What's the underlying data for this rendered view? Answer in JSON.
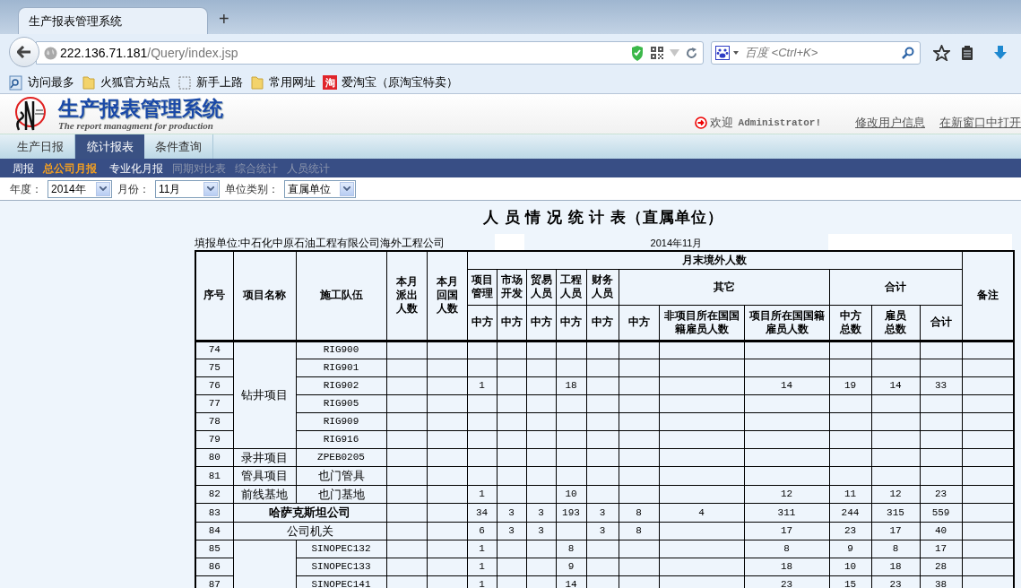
{
  "browser": {
    "tab_title": "生产报表管理系统",
    "new_tab": "+",
    "url_host": "222.136.71.181",
    "url_path": "/Query/index.jsp",
    "search_placeholder": "百度 <Ctrl+K>",
    "bookmarks": [
      {
        "label": "访问最多",
        "kind": "smart"
      },
      {
        "label": "火狐官方站点",
        "kind": "folder"
      },
      {
        "label": "新手上路",
        "kind": "page"
      },
      {
        "label": "常用网址",
        "kind": "folder"
      },
      {
        "label": "爱淘宝（原淘宝特卖）",
        "kind": "taobao",
        "icon_text": "淘"
      }
    ]
  },
  "app": {
    "title": "生产报表管理系统",
    "subtitle": "The report managment for production",
    "welcome": "欢迎",
    "user": "Administrator!",
    "links": [
      "修改用户信息",
      "在新窗口中打开"
    ],
    "tabs": [
      {
        "label": "生产日报",
        "selected": false
      },
      {
        "label": "统计报表",
        "selected": true
      },
      {
        "label": "条件查询",
        "selected": false
      }
    ],
    "subnav": [
      {
        "label": "周报",
        "selected": false,
        "disabled": false
      },
      {
        "label": "总公司月报",
        "selected": true,
        "disabled": false
      },
      {
        "label": "专业化月报",
        "selected": false,
        "disabled": false
      },
      {
        "label": "同期对比表",
        "selected": false,
        "disabled": true
      },
      {
        "label": "综合统计",
        "selected": false,
        "disabled": true
      },
      {
        "label": "人员统计",
        "selected": false,
        "disabled": true
      }
    ],
    "filters": [
      {
        "label": "年度：",
        "value": "2014年"
      },
      {
        "label": "月份：",
        "value": "11月"
      },
      {
        "label": "单位类别：",
        "value": "直属单位"
      }
    ]
  },
  "report": {
    "title": "人 员 情 况 统 计 表（直属单位）",
    "unit": "填报单位:中石化中原石油工程有限公司海外工程公司",
    "period": "2014年11月",
    "header": {
      "no": "序号",
      "project": "项目名称",
      "team": "施工队伍",
      "sent": "本月派出人数",
      "returned": "本月回国人数",
      "group": "月末境外人数",
      "mgmt": "项目管理",
      "market": "市场开发",
      "trade": "贸易人员",
      "eng": "工程人员",
      "finance": "财务人员",
      "other": "其它",
      "sum": "合计",
      "remark": "备注",
      "sub": [
        "中方",
        "中方",
        "中方",
        "中方",
        "中方",
        "中方",
        "非项目所在国国籍雇员人数",
        "项目所在国国籍雇员人数",
        "中方总数",
        "雇员总数",
        "合计"
      ]
    },
    "sections": [
      {
        "kind": "group",
        "project": "钻井项目",
        "rows": [
          {
            "no": "74",
            "team": "RIG900",
            "values": {}
          },
          {
            "no": "75",
            "team": "RIG901",
            "values": {}
          },
          {
            "no": "76",
            "team": "RIG902",
            "values": {
              "mgmt": "1",
              "eng": "18",
              "other_local": "14",
              "total_cn": "19",
              "total_emp": "14",
              "total": "33"
            }
          },
          {
            "no": "77",
            "team": "RIG905",
            "values": {}
          },
          {
            "no": "78",
            "team": "RIG909",
            "values": {}
          },
          {
            "no": "79",
            "team": "RIG916",
            "values": {}
          }
        ]
      },
      {
        "kind": "group",
        "project": "录井项目",
        "rows": [
          {
            "no": "80",
            "team": "ZPEB0205",
            "values": {}
          }
        ]
      },
      {
        "kind": "group",
        "project": "管具项目",
        "rows": [
          {
            "no": "81",
            "team": "也门管具",
            "values": {}
          }
        ]
      },
      {
        "kind": "group",
        "project": "前线基地",
        "rows": [
          {
            "no": "82",
            "team": "也门基地",
            "values": {
              "mgmt": "1",
              "eng": "10",
              "other_local": "12",
              "total_cn": "11",
              "total_emp": "12",
              "total": "23"
            }
          }
        ]
      },
      {
        "kind": "total",
        "no": "83",
        "name": "哈萨克斯坦公司",
        "values": {
          "mgmt": "34",
          "market": "3",
          "trade": "3",
          "eng": "193",
          "finance": "3",
          "other_cn": "8",
          "other_third": "4",
          "other_local": "311",
          "total_cn": "244",
          "total_emp": "315",
          "total": "559"
        }
      },
      {
        "kind": "unit",
        "no": "84",
        "name": "公司机关",
        "values": {
          "mgmt": "6",
          "market": "3",
          "trade": "3",
          "finance": "3",
          "other_cn": "8",
          "other_local": "17",
          "total_cn": "23",
          "total_emp": "17",
          "total": "40"
        }
      },
      {
        "kind": "group",
        "rows": [
          {
            "no": "85",
            "team": "SINOPEC132",
            "values": {
              "mgmt": "1",
              "eng": "8",
              "other_local": "8",
              "total_cn": "9",
              "total_emp": "8",
              "total": "17"
            }
          },
          {
            "no": "86",
            "team": "SINOPEC133",
            "values": {
              "mgmt": "1",
              "eng": "9",
              "other_local": "18",
              "total_cn": "10",
              "total_emp": "18",
              "total": "28"
            }
          },
          {
            "no": "87",
            "team": "SINOPEC141",
            "values": {
              "mgmt": "1",
              "eng": "14",
              "other_local": "23",
              "total_cn": "15",
              "total_emp": "23",
              "total": "38"
            }
          }
        ]
      }
    ]
  }
}
